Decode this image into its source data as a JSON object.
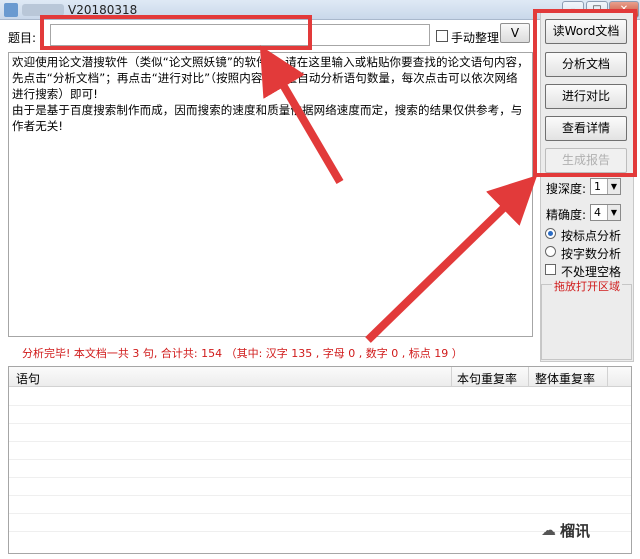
{
  "window": {
    "title": "V20180318",
    "controls": {
      "minimize": "–",
      "maximize": "□",
      "close": "✕"
    }
  },
  "topic": {
    "label": "题目:",
    "value": "",
    "manual_label": "手动整理",
    "v_button": "V"
  },
  "main_text": {
    "paragraphs": [
      "欢迎使用论文潜搜软件（类似“论文照妖镜”的软件），请在这里输入或粘贴你要查找的论文语句内容，先点击“分析文档”；再点击“进行对比”（按照内容的数量自动分析语句数量，每次点击可以依次网络进行搜索）即可!",
      "由于是基于百度搜索制作而成，因而搜索的速度和质量依据网络速度而定，搜索的结果仅供参考，与作者无关!"
    ]
  },
  "status": "分析完毕! 本文档一共 3 句, 合计共: 154 （其中: 汉字 135 , 字母 0 , 数字 0 , 标点 19 ）",
  "sidebar": {
    "buttons": [
      {
        "label": "读Word文档",
        "enabled": true
      },
      {
        "label": "分析文档",
        "enabled": true
      },
      {
        "label": "进行对比",
        "enabled": true
      },
      {
        "label": "查看详情",
        "enabled": true
      },
      {
        "label": "生成报告",
        "enabled": false
      }
    ],
    "depth_label": "搜深度:",
    "depth_value": "1",
    "precision_label": "精确度:",
    "precision_value": "4",
    "radio_punct": "按标点分析",
    "radio_chars": "按字数分析",
    "radio_selected": "按标点分析",
    "no_space_label": "不处理空格",
    "drop_zone_label": "拖放打开区域"
  },
  "table": {
    "columns": [
      "语句",
      "本句重复率",
      "整体重复率"
    ],
    "rows": []
  },
  "watermark": "榴讯",
  "colors": {
    "annotation_red": "#e23a3a",
    "status_red": "#d01a1a"
  }
}
